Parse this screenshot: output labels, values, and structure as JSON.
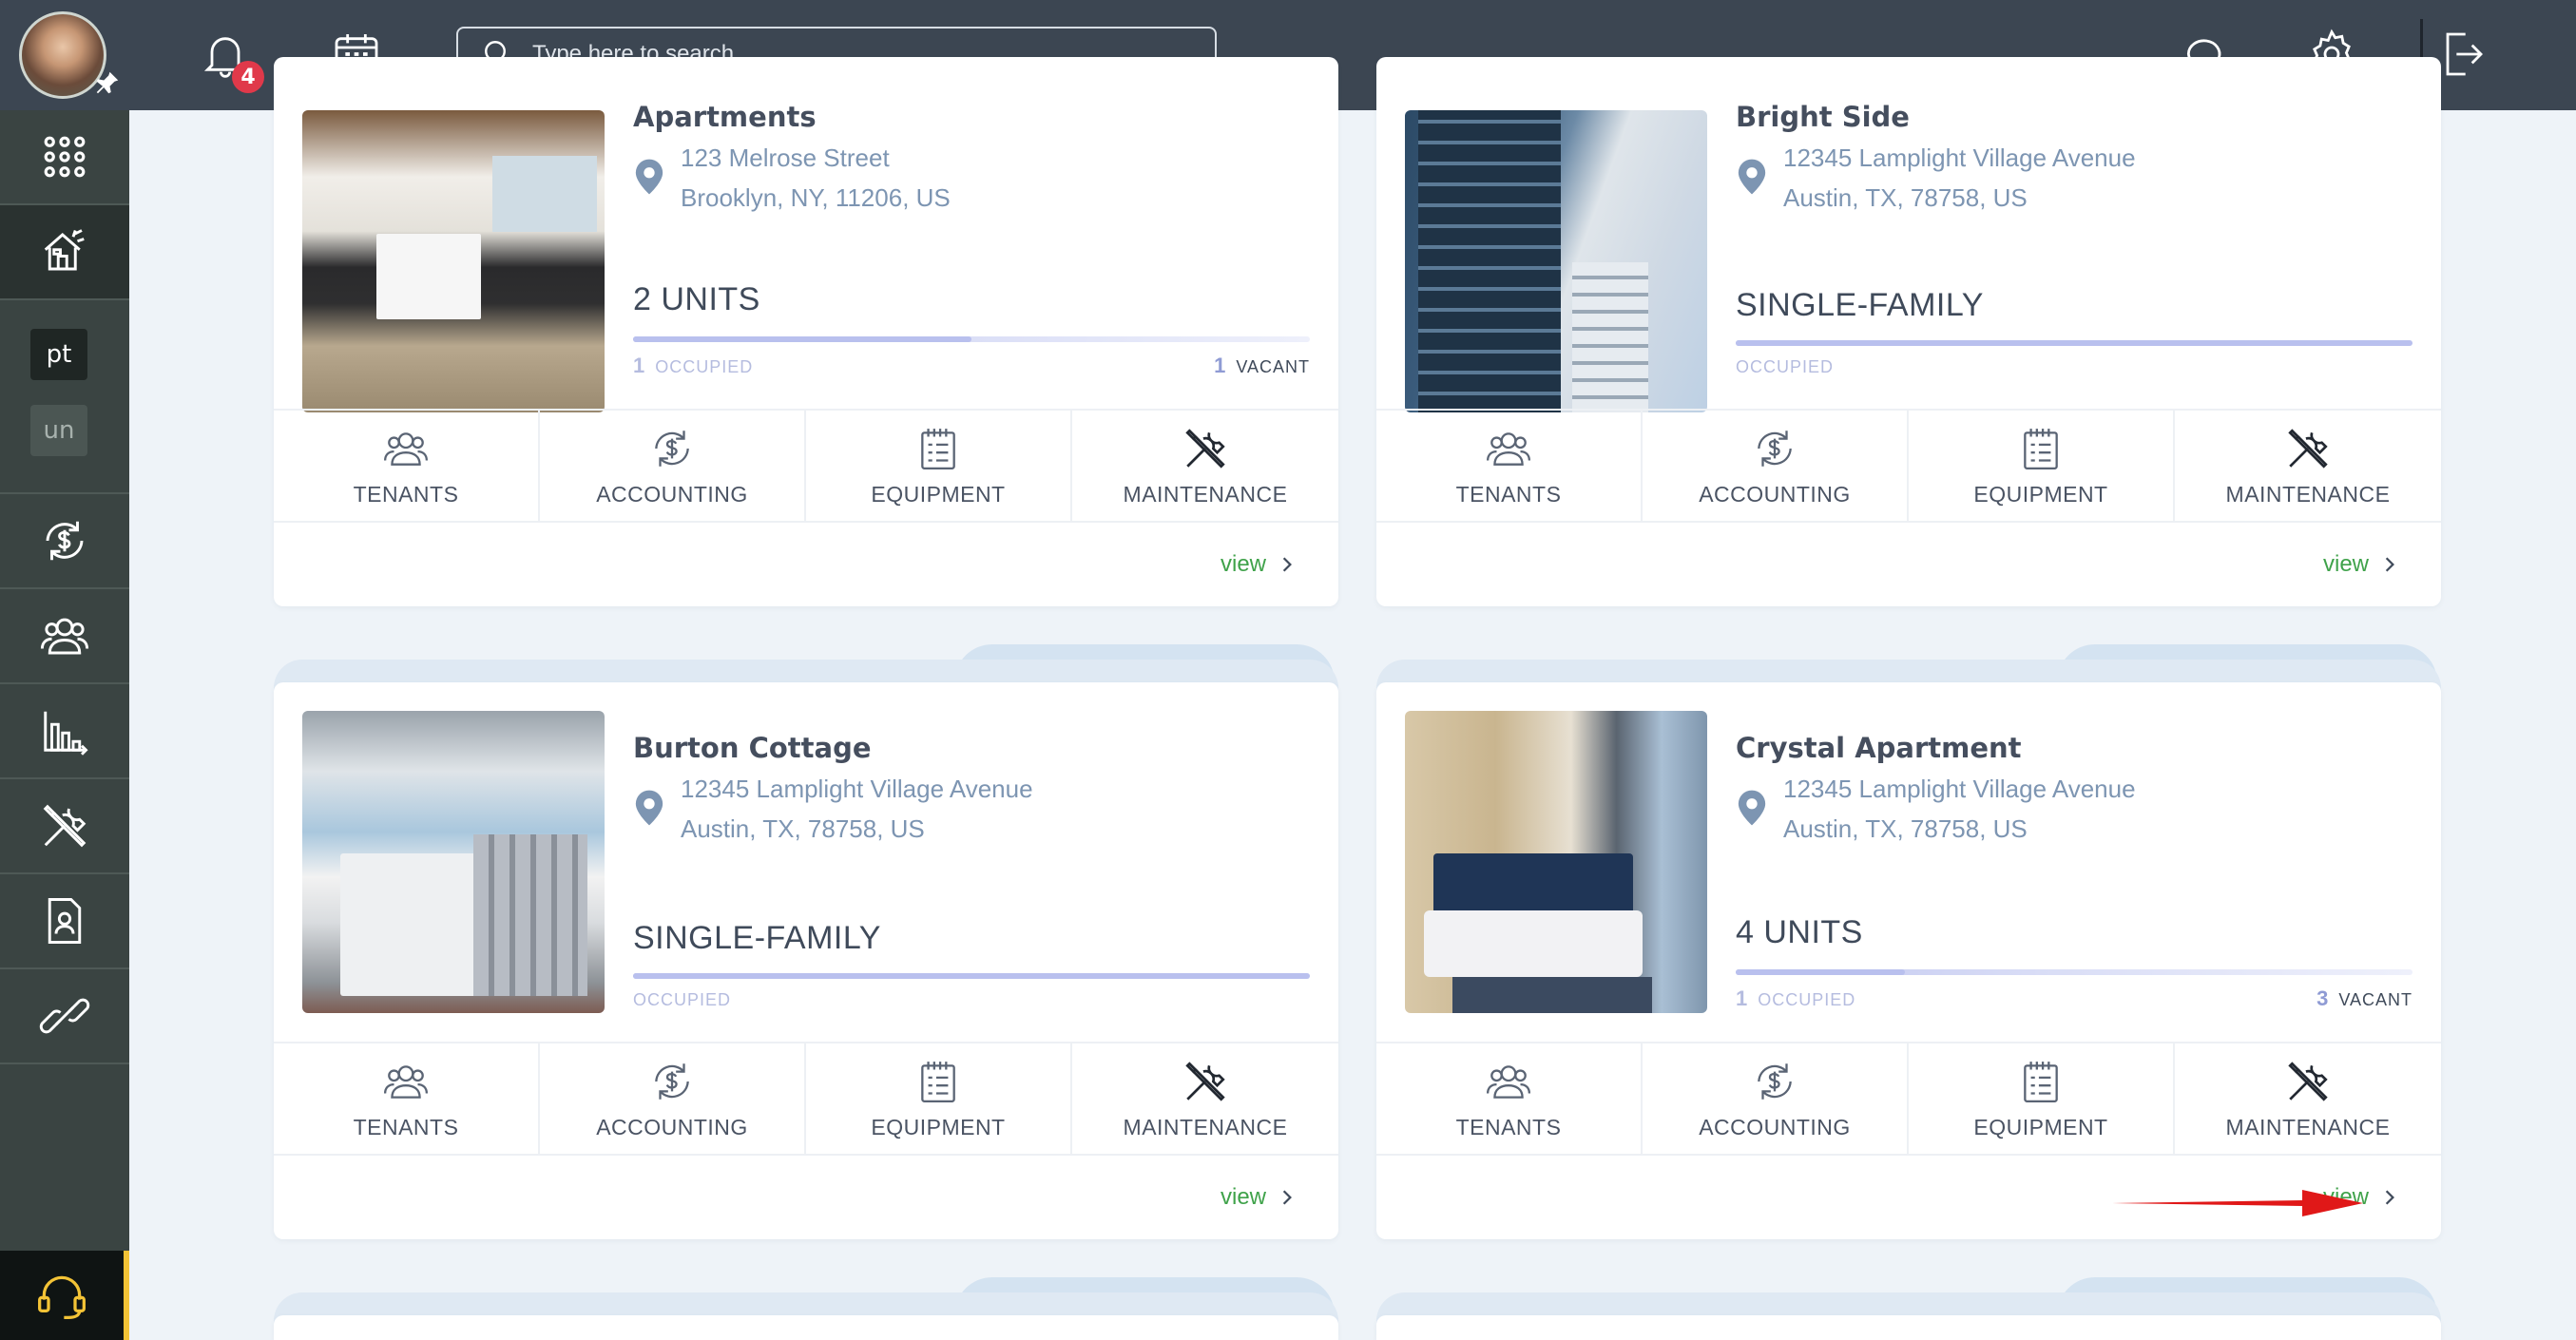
{
  "topbar": {
    "notification_count": "4",
    "search_placeholder": "Type here to search..."
  },
  "sidebar": {
    "chips": [
      "pt",
      "un"
    ]
  },
  "actions": [
    "TENANTS",
    "ACCOUNTING",
    "EQUIPMENT",
    "MAINTENANCE"
  ],
  "view_label": "view",
  "properties": [
    {
      "name": "Apartments",
      "address_line1": "123 Melrose Street",
      "address_line2": "Brooklyn, NY, 11206, US",
      "type_label": "2 UNITS",
      "occupied_count": "1",
      "occupied_label": "OCCUPIED",
      "vacant_count": "1",
      "vacant_label": "VACANT",
      "occupancy_fraction": 0.5
    },
    {
      "name": "Bright Side",
      "address_line1": "12345 Lamplight Village Avenue",
      "address_line2": "Austin, TX, 78758, US",
      "type_label": "SINGLE-FAMILY",
      "occupied_label": "OCCUPIED",
      "occupancy_fraction": 1.0
    },
    {
      "name": "Burton Cottage",
      "address_line1": "12345 Lamplight Village Avenue",
      "address_line2": "Austin, TX, 78758, US",
      "type_label": "SINGLE-FAMILY",
      "occupied_label": "OCCUPIED",
      "occupancy_fraction": 1.0
    },
    {
      "name": "Crystal Apartment",
      "address_line1": "12345 Lamplight Village Avenue",
      "address_line2": "Austin, TX, 78758, US",
      "type_label": "4 UNITS",
      "occupied_count": "1",
      "occupied_label": "OCCUPIED",
      "vacant_count": "3",
      "vacant_label": "VACANT",
      "occupancy_fraction": 0.25
    }
  ],
  "colors": {
    "topbar": "#3c4652",
    "sidebar": "#3a4442",
    "view_link": "#3fa24a",
    "address": "#7d95b2",
    "badge": "#e0394a",
    "support_accent": "#f3c336",
    "annotation_arrow": "#e01818"
  }
}
